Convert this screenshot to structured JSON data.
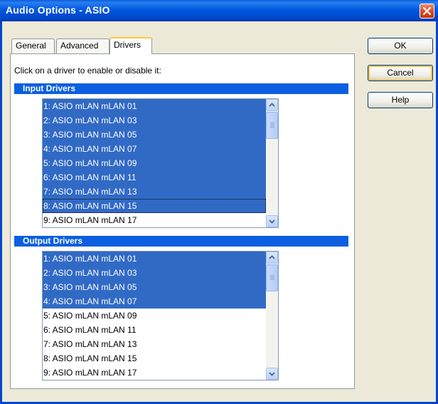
{
  "window": {
    "title": "Audio Options - ASIO"
  },
  "tabs": [
    {
      "label": "General",
      "active": false
    },
    {
      "label": "Advanced",
      "active": false
    },
    {
      "label": "Drivers",
      "active": true
    }
  ],
  "instruction": "Click on a driver to enable or disable it:",
  "input_drivers": {
    "header": "Input Drivers",
    "items": [
      {
        "label": "1: ASIO mLAN mLAN 01",
        "selected": true
      },
      {
        "label": "2: ASIO mLAN mLAN 03",
        "selected": true
      },
      {
        "label": "3: ASIO mLAN mLAN 05",
        "selected": true
      },
      {
        "label": "4: ASIO mLAN mLAN 07",
        "selected": true
      },
      {
        "label": "5: ASIO mLAN mLAN 09",
        "selected": true
      },
      {
        "label": "6: ASIO mLAN mLAN 11",
        "selected": true
      },
      {
        "label": "7: ASIO mLAN mLAN 13",
        "selected": true
      },
      {
        "label": "8: ASIO mLAN mLAN 15",
        "selected": true,
        "focused": true
      },
      {
        "label": "9: ASIO mLAN mLAN 17",
        "selected": false
      }
    ]
  },
  "output_drivers": {
    "header": "Output Drivers",
    "items": [
      {
        "label": "1: ASIO mLAN mLAN 01",
        "selected": true
      },
      {
        "label": "2: ASIO mLAN mLAN 03",
        "selected": true
      },
      {
        "label": "3: ASIO mLAN mLAN 05",
        "selected": true
      },
      {
        "label": "4: ASIO mLAN mLAN 07",
        "selected": true
      },
      {
        "label": "5: ASIO mLAN mLAN 09",
        "selected": false
      },
      {
        "label": "6: ASIO mLAN mLAN 11",
        "selected": false
      },
      {
        "label": "7: ASIO mLAN mLAN 13",
        "selected": false
      },
      {
        "label": "8: ASIO mLAN mLAN 15",
        "selected": false
      },
      {
        "label": "9: ASIO mLAN mLAN 17",
        "selected": false
      }
    ]
  },
  "buttons": {
    "ok": "OK",
    "cancel": "Cancel",
    "help": "Help"
  },
  "colors": {
    "titlebar": "#0058e0",
    "selection": "#316ac5",
    "group_header": "#0b5fe0",
    "dialog_background": "#ece9d8"
  },
  "icons": {
    "close": "close-icon",
    "scroll_up": "arrow-up-icon",
    "scroll_down": "arrow-down-icon"
  }
}
